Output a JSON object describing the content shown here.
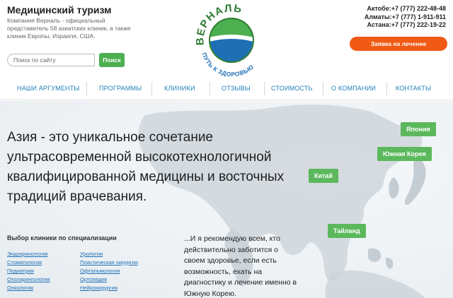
{
  "header": {
    "brand_title": "Медицинский туризм",
    "brand_description": "Компания Верналь - официальный представитель 58 азиатских клиник, а также клиник Европы, Израиля, США.",
    "search": {
      "placeholder": "Поиск по сайту",
      "button_label": "Поиск"
    },
    "logo": {
      "top_text": "ВЕРНАЛЬ",
      "bottom_text": "ПУТЬ К ЗДОРОВЬЮ"
    },
    "contacts": [
      "Актобе:+7 (777) 222-48-48",
      "Алматы:+7 (777) 1-911-911",
      "Астана:+7 (777) 222-19-22"
    ],
    "cta_label": "Заявка на лечение"
  },
  "nav": {
    "items": [
      "НАШИ АРГУМЕНТЫ",
      "ПРОГРАММЫ",
      "КЛИНИКИ",
      "ОТЗЫВЫ",
      "СТОИМОСТЬ",
      "О КОМПАНИИ",
      "КОНТАКТЫ"
    ]
  },
  "hero": {
    "title": "Азия - это уникальное сочетание ультрасовременной высокотехнологичной квалифицированной медицины и восточных традиций врачевания.",
    "countries": [
      "Япония",
      "Южная Корея",
      "Китай",
      "Тайланд"
    ],
    "quote": "...И я рекомендую всем, кто действительно заботится о своем здоровье, если есть возможность, ехать на диагностику и лечение именно в Южную Корею."
  },
  "specializations": {
    "title": "Выбор клиники по специализации",
    "left": [
      "Эндокринология",
      "Стоматология",
      "Педиатрия",
      "Отоларингология",
      "Онкология"
    ],
    "right": [
      "Урология",
      "Пластическая хирургия",
      "Офтальмология",
      "Ортопедия",
      "Нейрохирургия"
    ]
  },
  "colors": {
    "accent_green": "#5cb85c",
    "cta_orange": "#f05a14",
    "nav_blue": "#1d7fb8",
    "logo_blue": "#1f6fb5"
  }
}
